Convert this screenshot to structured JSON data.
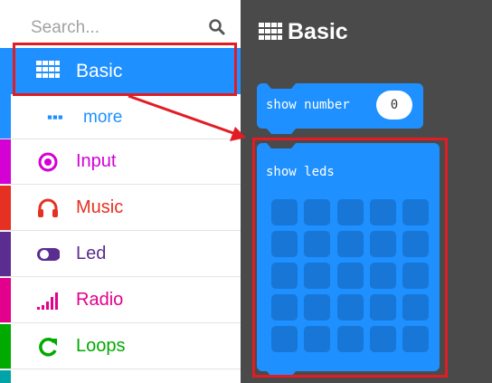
{
  "search": {
    "placeholder": "Search..."
  },
  "categories": [
    {
      "label": "Basic",
      "color": "#ffffff",
      "bg": "#1e90ff",
      "icon": "grid-icon",
      "selected": true
    },
    {
      "label": "more",
      "color": "#1e90ff",
      "icon": "dots-icon"
    },
    {
      "label": "Input",
      "color": "#d400d4",
      "icon": "target-icon"
    },
    {
      "label": "Music",
      "color": "#e63022",
      "icon": "headphones-icon"
    },
    {
      "label": "Led",
      "color": "#5c2d91",
      "icon": "toggle-icon"
    },
    {
      "label": "Radio",
      "color": "#e3008c",
      "icon": "signal-icon"
    },
    {
      "label": "Loops",
      "color": "#00aa00",
      "icon": "refresh-icon"
    }
  ],
  "flyout": {
    "title": "Basic",
    "blocks": [
      {
        "label": "show number",
        "value": "0"
      },
      {
        "label": "show leds"
      }
    ]
  },
  "colors": {
    "block": "#1e90ff",
    "led_off": "#1877d6",
    "panel": "#4a4a4a",
    "highlight": "#e31b23"
  },
  "led_grid": {
    "rows": 5,
    "cols": 5
  }
}
